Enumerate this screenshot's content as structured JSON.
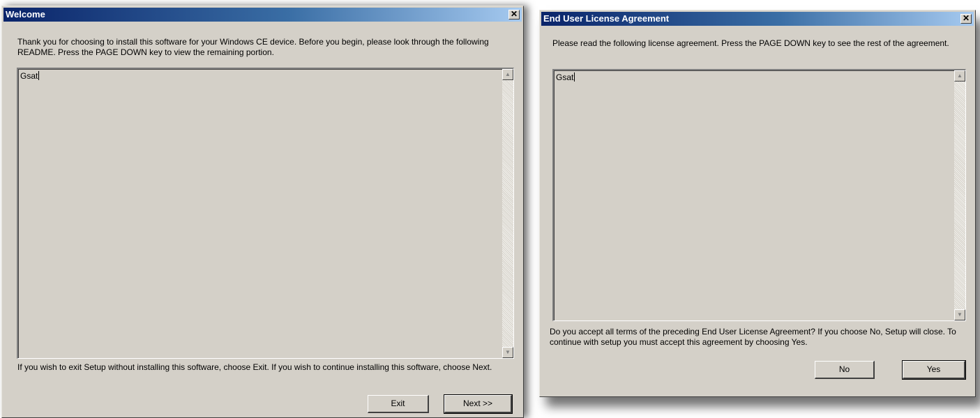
{
  "welcome_dialog": {
    "title": "Welcome",
    "close_label": "✕",
    "intro_text": "Thank you for choosing to install this software for your Windows CE device. Before you begin, please look through the following README. Press the PAGE DOWN key to view the remaining portion.",
    "readme_text": "Gsat",
    "footer_text": "If you wish to exit Setup without installing this software, choose Exit. If you wish to continue installing this software, choose Next.",
    "exit_label": "Exit",
    "next_label": "Next >>"
  },
  "eula_dialog": {
    "title": "End User License Agreement",
    "close_label": "✕",
    "intro_text": "Please read the following license agreement. Press the PAGE DOWN key to see the rest of the agreement.",
    "license_text": "Gsat",
    "question_text": "Do you accept all terms of the preceding End User License Agreement? If you choose No, Setup will close. To continue with setup you must accept this agreement by choosing Yes.",
    "no_label": "No",
    "yes_label": "Yes"
  },
  "icons": {
    "scroll_up": "▲",
    "scroll_down": "▼"
  }
}
